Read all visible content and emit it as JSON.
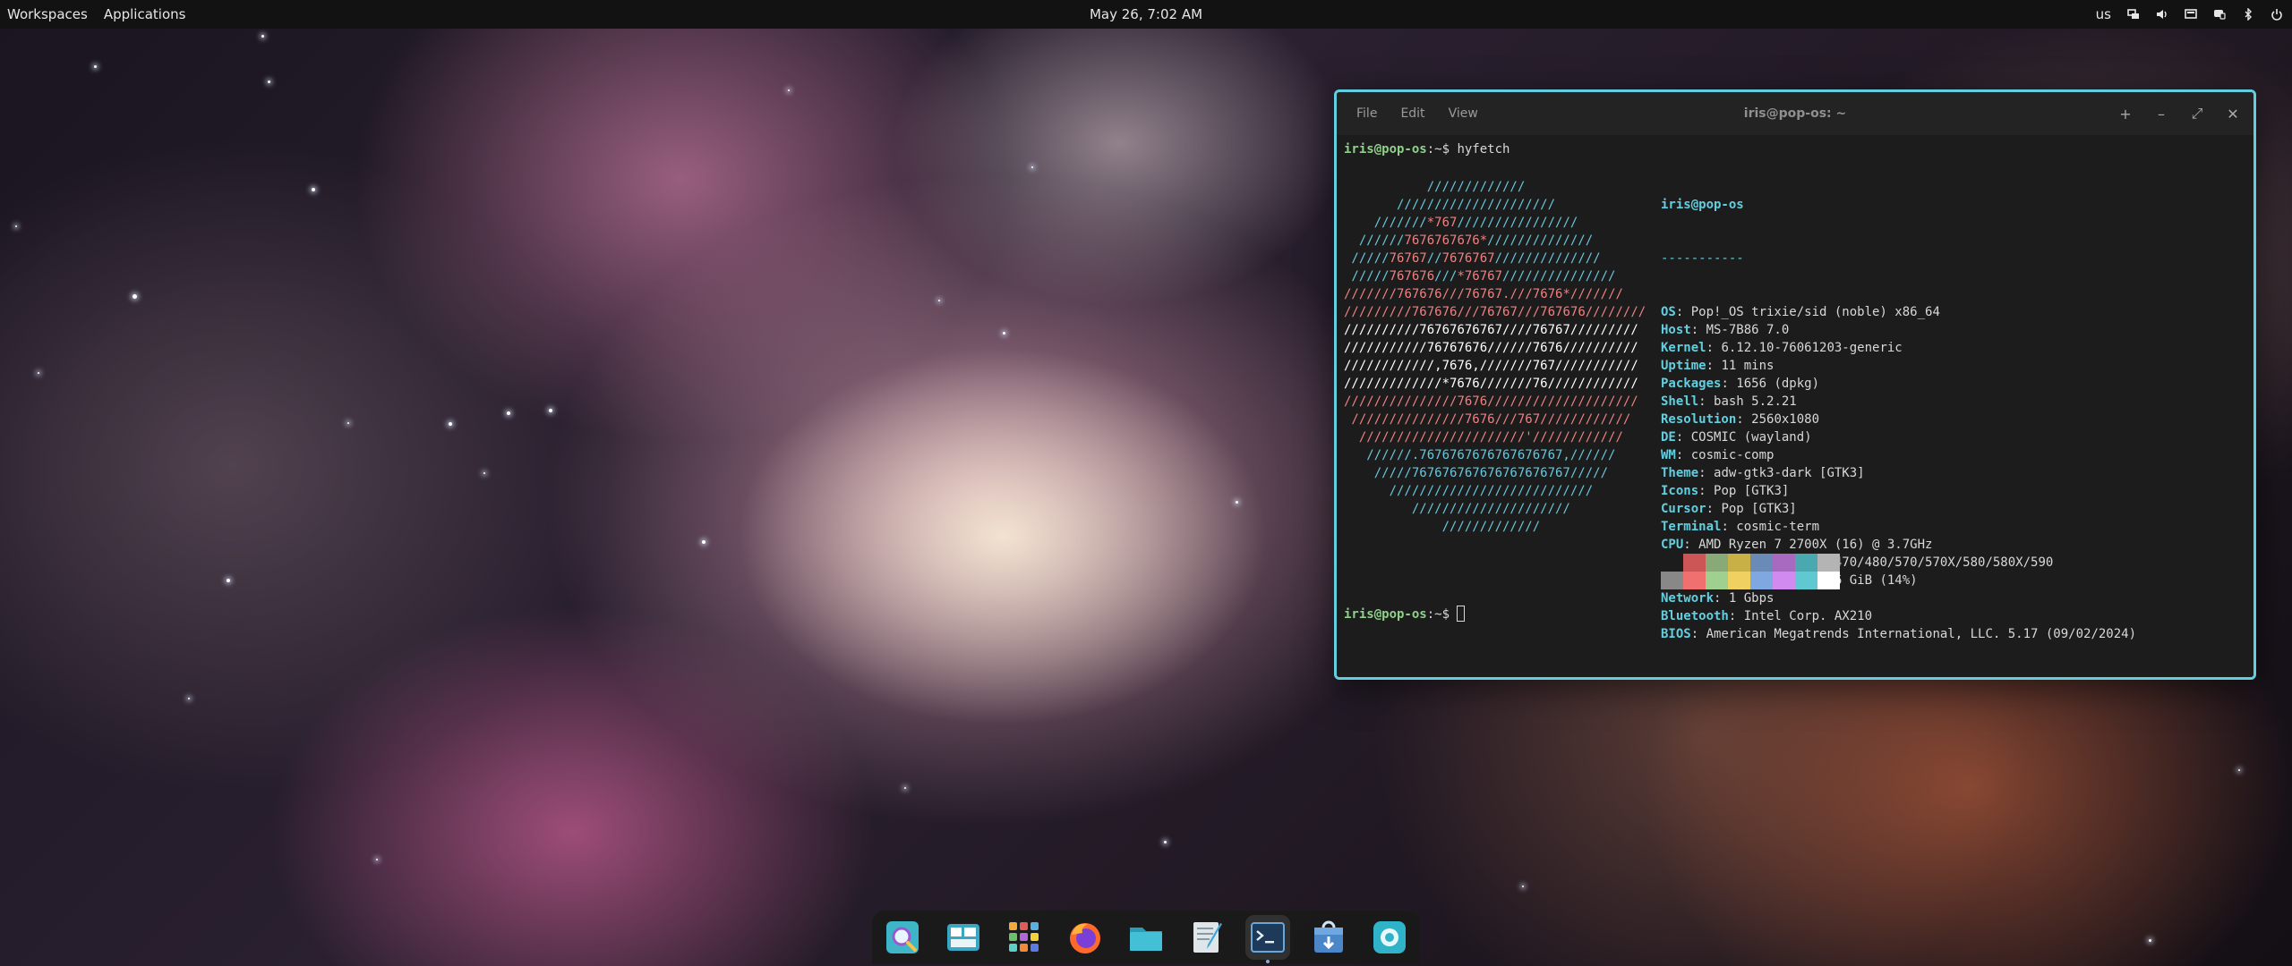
{
  "panel": {
    "workspaces_label": "Workspaces",
    "applications_label": "Applications",
    "datetime": "May 26, 7:02 AM",
    "keyboard_layout": "us",
    "tray_icons": [
      "workspaces-tray-icon",
      "volume-icon",
      "display-icon",
      "notifications-icon",
      "bluetooth-icon",
      "power-icon"
    ]
  },
  "terminal": {
    "menu": [
      "File",
      "Edit",
      "View"
    ],
    "title": "iris@pop-os: ~",
    "buttons": [
      "+",
      "–",
      "⤢",
      "✕"
    ],
    "prompt_user": "iris@pop-os",
    "prompt_path": ":~$ ",
    "command": "hyfetch",
    "prompt2_path": ":~$ ",
    "ascii_lines": [
      [
        [
          "c1",
          "           /////////////"
        ]
      ],
      [
        [
          "c1",
          "       /////////////////////"
        ]
      ],
      [
        [
          "c1",
          "    ///////"
        ],
        [
          "c2",
          "*767"
        ],
        [
          "c1",
          "////////////////"
        ]
      ],
      [
        [
          "c1",
          "  //////"
        ],
        [
          "c2",
          "7676767676*"
        ],
        [
          "c1",
          "//////////////"
        ]
      ],
      [
        [
          "c1",
          " /////"
        ],
        [
          "c2",
          "76767"
        ],
        [
          "c1",
          "//"
        ],
        [
          "c2",
          "7676767"
        ],
        [
          "c1",
          "//////////////"
        ]
      ],
      [
        [
          "c1",
          " /////"
        ],
        [
          "c2",
          "767676"
        ],
        [
          "c1",
          "///"
        ],
        [
          "c2",
          "*76767"
        ],
        [
          "c1",
          "///////////////"
        ]
      ],
      [
        [
          "c2",
          "///////"
        ],
        [
          "c2",
          "767676"
        ],
        [
          "c2",
          "///"
        ],
        [
          "c2",
          "76767"
        ],
        [
          "c2",
          ".///"
        ],
        [
          "c2",
          "7676*"
        ],
        [
          "c2",
          "///////"
        ]
      ],
      [
        [
          "c2",
          "/////////"
        ],
        [
          "c2",
          "767676"
        ],
        [
          "c2",
          "//"
        ],
        [
          "c2",
          "/76767"
        ],
        [
          "c2",
          "///"
        ],
        [
          "c2",
          "767676"
        ],
        [
          "c2",
          "////////"
        ]
      ],
      [
        [
          "c3",
          "//////////"
        ],
        [
          "c3",
          "76767676767"
        ],
        [
          "c3",
          "////"
        ],
        [
          "c3",
          "76767"
        ],
        [
          "c3",
          "/////////"
        ]
      ],
      [
        [
          "c3",
          "///////////"
        ],
        [
          "c3",
          "76767676"
        ],
        [
          "c3",
          "//////"
        ],
        [
          "c3",
          "7676"
        ],
        [
          "c3",
          "//////////"
        ]
      ],
      [
        [
          "c3",
          "////////////"
        ],
        [
          "c3",
          ",7676,"
        ],
        [
          "c3",
          "///////"
        ],
        [
          "c3",
          "767"
        ],
        [
          "c3",
          "///////////"
        ]
      ],
      [
        [
          "c3",
          "/////////////"
        ],
        [
          "c3",
          "*7676"
        ],
        [
          "c3",
          "///////"
        ],
        [
          "c3",
          "76"
        ],
        [
          "c3",
          "////////////"
        ]
      ],
      [
        [
          "c2",
          "///////////////"
        ],
        [
          "c2",
          "7676"
        ],
        [
          "c2",
          "////////////////////"
        ]
      ],
      [
        [
          "c2",
          " ///////////////"
        ],
        [
          "c2",
          "7676"
        ],
        [
          "c2",
          "///"
        ],
        [
          "c2",
          "767"
        ],
        [
          "c2",
          "////////////"
        ]
      ],
      [
        [
          "c2",
          "  //////////////////////"
        ],
        [
          "c2",
          "'"
        ],
        [
          "c2",
          "////////////"
        ]
      ],
      [
        [
          "c1",
          "   //////"
        ],
        [
          "c1",
          ".7676767676767676767,"
        ],
        [
          "c1",
          "//////"
        ]
      ],
      [
        [
          "c1",
          "    /////"
        ],
        [
          "c1",
          "767676767676767676767"
        ],
        [
          "c1",
          "/////"
        ]
      ],
      [
        [
          "c1",
          "      ///////////////////////////"
        ]
      ],
      [
        [
          "c1",
          "         /////////////////////"
        ]
      ],
      [
        [
          "c1",
          "             /////////////"
        ]
      ]
    ],
    "info_host": "iris@pop-os",
    "info_sep": "-----------",
    "info": [
      {
        "key": "OS",
        "value": "Pop!_OS trixie/sid (noble) x86_64"
      },
      {
        "key": "Host",
        "value": "MS-7B86 7.0"
      },
      {
        "key": "Kernel",
        "value": "6.12.10-76061203-generic"
      },
      {
        "key": "Uptime",
        "value": "11 mins"
      },
      {
        "key": "Packages",
        "value": "1656 (dpkg)"
      },
      {
        "key": "Shell",
        "value": "bash 5.2.21"
      },
      {
        "key": "Resolution",
        "value": "2560x1080"
      },
      {
        "key": "DE",
        "value": "COSMIC (wayland)"
      },
      {
        "key": "WM",
        "value": "cosmic-comp"
      },
      {
        "key": "Theme",
        "value": "adw-gtk3-dark [GTK3]"
      },
      {
        "key": "Icons",
        "value": "Pop [GTK3]"
      },
      {
        "key": "Cursor",
        "value": "Pop [GTK3]"
      },
      {
        "key": "Terminal",
        "value": "cosmic-term"
      },
      {
        "key": "CPU",
        "value": "AMD Ryzen 7 2700X (16) @ 3.7GHz"
      },
      {
        "key": "GPU",
        "value": "AMD ATI Radeon RX 470/480/570/570X/580/580X/590"
      },
      {
        "key": "Memory",
        "value": "4.58 GiB / 31.26 GiB (14%)"
      },
      {
        "key": "Network",
        "value": "1 Gbps"
      },
      {
        "key": "Bluetooth",
        "value": "Intel Corp. AX210"
      },
      {
        "key": "BIOS",
        "value": "American Megatrends International, LLC. 5.17 (09/02/2024)"
      }
    ],
    "palette_top": [
      "#1c1c1c",
      "#cc5555",
      "#88aa77",
      "#c8b046",
      "#6a8ab8",
      "#a86ac0",
      "#4aa8b0",
      "#b4b4b4"
    ],
    "palette_bottom": [
      "#888888",
      "#f07070",
      "#a0d090",
      "#f0d060",
      "#80a8e0",
      "#d08af0",
      "#60c8d0",
      "#ffffff"
    ]
  },
  "dock": {
    "apps": [
      {
        "name": "launcher-app-icon",
        "active": false
      },
      {
        "name": "workspaces-app-icon",
        "active": false
      },
      {
        "name": "app-library-icon",
        "active": false
      },
      {
        "name": "firefox-icon",
        "active": false
      },
      {
        "name": "files-icon",
        "active": false
      },
      {
        "name": "text-editor-icon",
        "active": false
      },
      {
        "name": "terminal-icon",
        "active": true
      },
      {
        "name": "store-icon",
        "active": false
      },
      {
        "name": "settings-icon",
        "active": false
      }
    ]
  }
}
